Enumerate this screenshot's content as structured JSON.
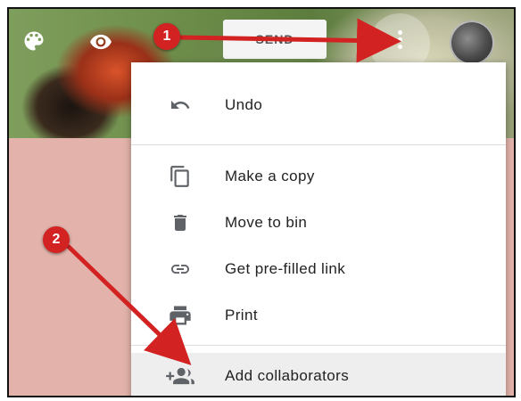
{
  "header": {
    "send_label": "SEND",
    "icons": [
      "palette-icon",
      "eye-icon",
      "more-vert-icon"
    ]
  },
  "menu": {
    "items": [
      {
        "label": "Undo",
        "icon": "undo-icon"
      },
      {
        "label": "Make a copy",
        "icon": "copy-icon"
      },
      {
        "label": "Move to bin",
        "icon": "trash-icon"
      },
      {
        "label": "Get pre-filled link",
        "icon": "link-icon"
      },
      {
        "label": "Print",
        "icon": "print-icon"
      },
      {
        "label": "Add collaborators",
        "icon": "add-people-icon"
      }
    ]
  },
  "annotations": [
    {
      "number": "1",
      "color": "#d32222"
    },
    {
      "number": "2",
      "color": "#d32222"
    }
  ],
  "colors": {
    "page_background": "#e3b3ab",
    "menu_background": "#ffffff",
    "highlight": "#eeeeee",
    "badge": "#d32222"
  }
}
